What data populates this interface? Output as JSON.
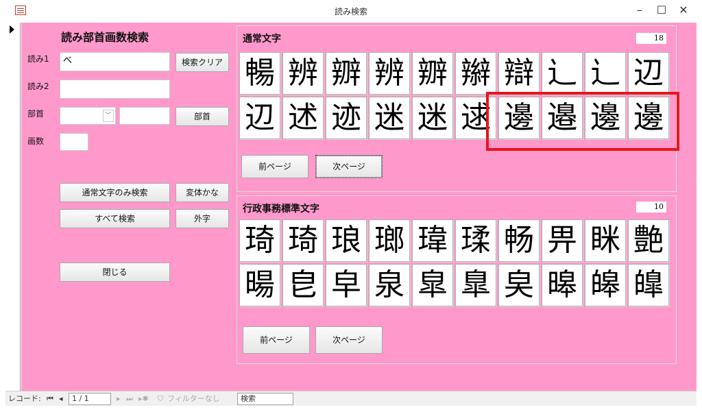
{
  "window": {
    "title": "読み検索",
    "minimize": "–",
    "maximize": "☐",
    "close": "✕"
  },
  "search": {
    "heading": "読み部首画数検索",
    "reading1_label": "読み1",
    "reading1_value": "べ",
    "reading2_label": "読み2",
    "reading2_value": "",
    "radical_label": "部首",
    "radical_select_value": "",
    "radical_text_value": "",
    "strokes_label": "画数",
    "strokes_value": "",
    "clear_button": "検索クリア",
    "radical_button": "部首",
    "normal_only_button": "通常文字のみ検索",
    "variant_kana_button": "変体かな",
    "search_all_button": "すべて検索",
    "external_char_button": "外字",
    "close_button": "閉じる"
  },
  "normal_panel": {
    "title": "通常文字",
    "count": "18",
    "chars": [
      "暢",
      "辨",
      "辧",
      "辨",
      "辧",
      "辮",
      "辯",
      "辶",
      "辶",
      "辺",
      "辺",
      "述",
      "迹",
      "迷",
      "迷",
      "逑",
      "邊",
      "邉",
      "邊",
      "邊"
    ],
    "prev_button": "前ページ",
    "next_button": "次ページ"
  },
  "admin_panel": {
    "title": "行政事務標準文字",
    "count": "10",
    "chars": [
      "琦",
      "琦",
      "琅",
      "瑯",
      "瑋",
      "瑈",
      "畅",
      "畀",
      "眯",
      "艶",
      "暘",
      "皀",
      "皁",
      "泉",
      "皐",
      "臯",
      "㚖",
      "暤",
      "皞",
      "皥"
    ],
    "prev_button": "前ページ",
    "next_button": "次ページ"
  },
  "navbar": {
    "record_label": "レコード:",
    "first": "⏮",
    "prev": "◂",
    "position": "1 / 1",
    "next": "▸",
    "last": "⏭",
    "new": "▸✱",
    "filter_text": "フィルターなし",
    "search_placeholder": "検索"
  }
}
